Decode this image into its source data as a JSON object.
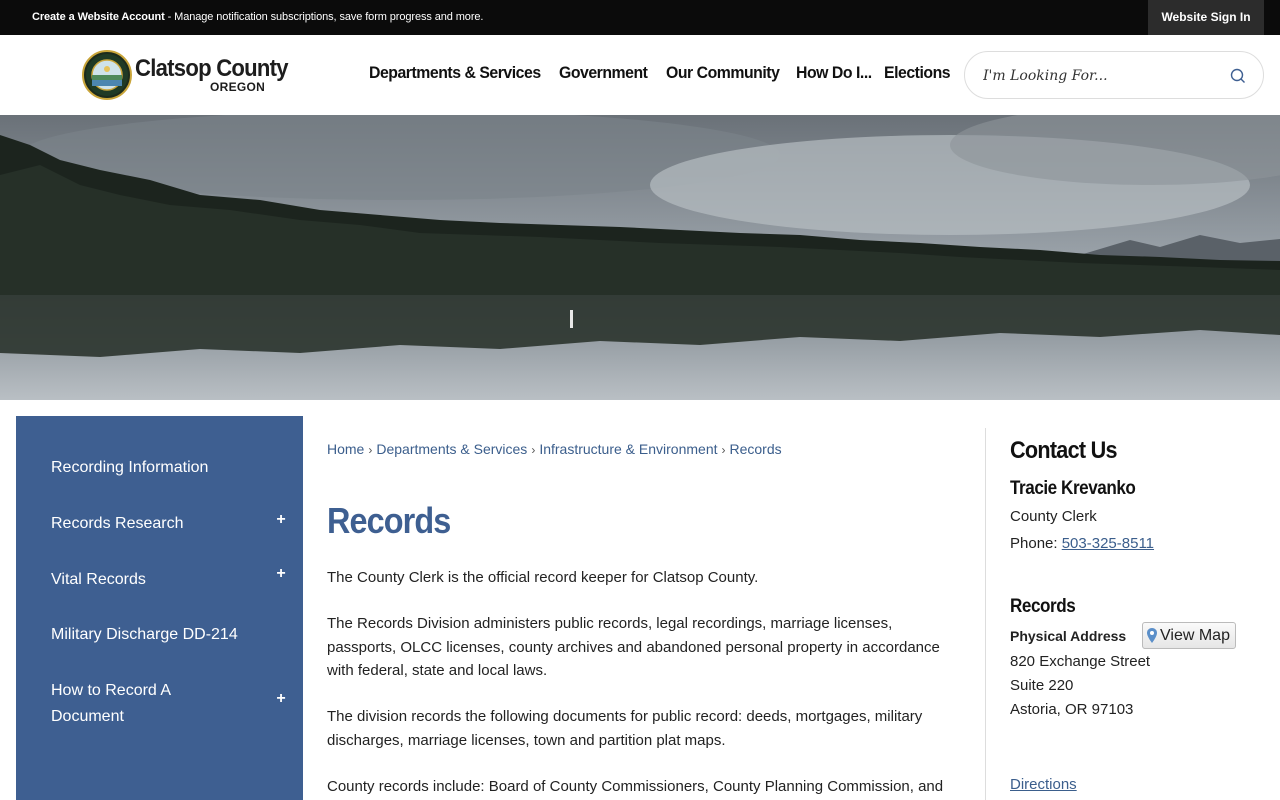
{
  "topbar": {
    "account_link": "Create a Website Account",
    "account_desc": " - Manage notification subscriptions, save form progress and more.",
    "signin": "Website Sign In"
  },
  "brand": {
    "name": "Clatsop County",
    "state": "OREGON"
  },
  "nav": {
    "items": [
      "Departments & Services",
      "Government",
      "Our Community",
      "How Do I...",
      "Elections"
    ]
  },
  "search": {
    "placeholder": "I'm Looking For..."
  },
  "sidebar": {
    "items": [
      {
        "label": "Recording Information",
        "expand": ""
      },
      {
        "label": "Records Research",
        "expand": "+"
      },
      {
        "label": "Vital Records",
        "expand": "+"
      },
      {
        "label": "Military Discharge DD-214",
        "expand": ""
      },
      {
        "label": "How to Record A Document",
        "expand": "+"
      }
    ]
  },
  "breadcrumb": {
    "items": [
      "Home",
      "Departments & Services",
      "Infrastructure & Environment",
      "Records"
    ],
    "separator": "›"
  },
  "main": {
    "title": "Records",
    "paragraphs": [
      "The County Clerk is the official record keeper for Clatsop County.",
      "The Records Division administers public records, legal recordings, marriage licenses, passports, OLCC licenses, county archives and abandoned personal property in accordance with federal, state and local laws.",
      "The division records the following documents for public record: deeds, mortgages, military discharges, marriage licenses, town and partition plat maps.",
      "County records include: Board of County Commissioners, County Planning Commission, and"
    ]
  },
  "contact": {
    "heading": "Contact Us",
    "person": "Tracie Krevanko",
    "role": "County Clerk",
    "phone_label": "Phone: ",
    "phone": "503-325-8511",
    "dept": "Records",
    "address_label": "Physical Address",
    "view_map": "View Map",
    "address": [
      "820 Exchange Street",
      "Suite 220",
      "Astoria, OR 97103"
    ],
    "directions": "Directions"
  },
  "colors": {
    "accent": "#3e5f91",
    "link": "#3b5e8c",
    "topbar": "#0b0b0b"
  }
}
